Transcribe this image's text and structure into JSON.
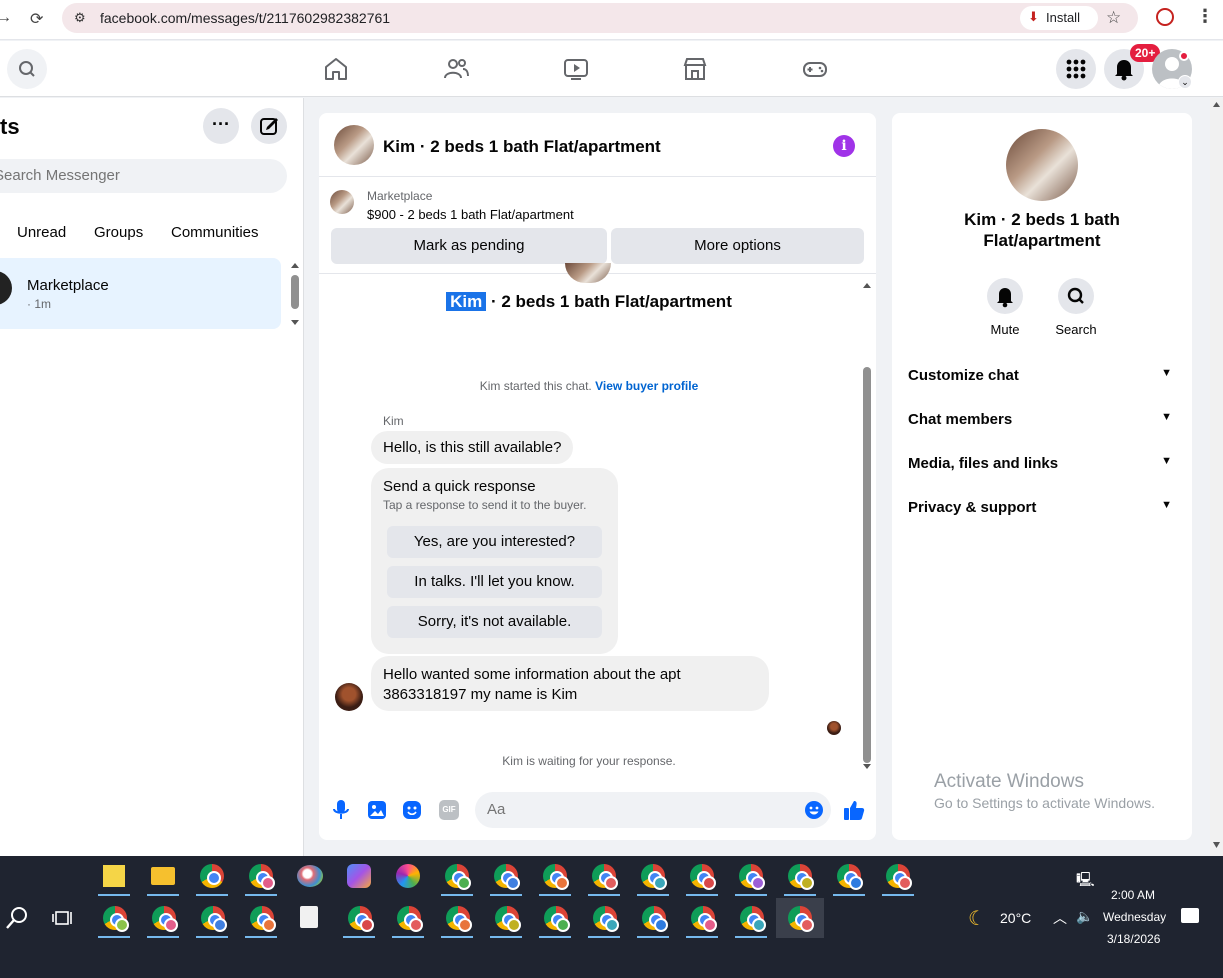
{
  "browser": {
    "url": "facebook.com/messages/t/2117602982382761",
    "install_label": "Install"
  },
  "fbnav": {
    "notification_badge": "20+"
  },
  "left": {
    "title": "ts",
    "search_placeholder": "Search Messenger",
    "filters": [
      "Unread",
      "Groups",
      "Communities"
    ],
    "chat": {
      "name": "Marketplace",
      "time": "· 1m"
    }
  },
  "center": {
    "title": "Kim · 2 beds 1 bath Flat/apartment",
    "marketplace_label": "Marketplace",
    "listing": "$900 - 2 beds 1 bath Flat/apartment",
    "mark_pending": "Mark as pending",
    "more_options": "More options",
    "intro_highlight": "Kim",
    "intro_rest": " · 2 beds 1 bath Flat/apartment",
    "started_text": "Kim started this chat. ",
    "view_buyer": "View buyer profile",
    "sender_name": "Kim",
    "msg1": "Hello, is this still available?",
    "quick_title": "Send a quick response",
    "quick_sub": "Tap a response to send it to the buyer.",
    "quick_responses": [
      "Yes, are you interested?",
      "In talks. I'll let you know.",
      "Sorry, it's not available."
    ],
    "msg2_line1": "Hello wanted some information about the apt",
    "msg2_line2": "3863318197 my name is Kim",
    "waiting": "Kim is waiting for your response.",
    "composer_placeholder": "Aa"
  },
  "right": {
    "name_line1": "Kim · 2 beds 1 bath",
    "name_line2": "Flat/apartment",
    "mute_label": "Mute",
    "search_label": "Search",
    "sections": [
      "Customize chat",
      "Chat members",
      "Media, files and links",
      "Privacy & support"
    ]
  },
  "watermark": {
    "title": "Activate Windows",
    "sub": "Go to Settings to activate Windows."
  },
  "taskbar": {
    "temperature": "20°C",
    "time": "2:00 AM",
    "day": "Wednesday",
    "date": "3/18/2026"
  },
  "colors": {
    "fb_blue": "#0866ff",
    "link_blue": "#0064d1",
    "info_purple": "#a033e8",
    "badge_red": "#e41e3f"
  }
}
